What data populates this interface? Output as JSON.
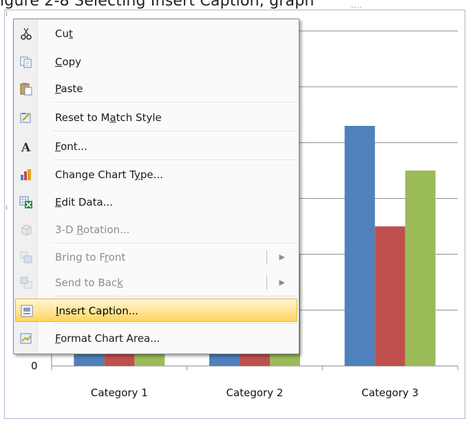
{
  "top_text": "igure 2-8 Selecting Insert Caption, graph",
  "chart_data": {
    "type": "bar",
    "categories": [
      "Category 1",
      "Category 2",
      "Category 3"
    ],
    "series": [
      {
        "values": [
          1.6,
          1.6,
          4.3
        ]
      },
      {
        "values": [
          1.6,
          1.6,
          2.5
        ]
      },
      {
        "values": [
          1.6,
          2.0,
          3.5
        ]
      }
    ],
    "ylim": [
      0,
      6
    ],
    "yticks_visible": [
      "0"
    ],
    "grid": true,
    "colors": [
      "#4f81bd",
      "#c0504d",
      "#9bbb59"
    ]
  },
  "menu": {
    "items": [
      {
        "key": "cut",
        "pre": "Cu",
        "ul": "t",
        "post": "",
        "icon": "scissors-icon",
        "disabled": false,
        "submenu": false,
        "highlight": false
      },
      {
        "key": "copy",
        "pre": "",
        "ul": "C",
        "post": "opy",
        "icon": "copy-icon",
        "disabled": false,
        "submenu": false,
        "highlight": false
      },
      {
        "key": "paste",
        "pre": "",
        "ul": "P",
        "post": "aste",
        "icon": "paste-icon",
        "disabled": false,
        "submenu": false,
        "highlight": false
      },
      {
        "key": "reset",
        "pre": "Reset to M",
        "ul": "a",
        "post": "tch Style",
        "icon": "reset-style-icon",
        "disabled": false,
        "submenu": false,
        "highlight": false
      },
      {
        "key": "font",
        "pre": "",
        "ul": "F",
        "post": "ont...",
        "icon": "font-icon",
        "disabled": false,
        "submenu": false,
        "highlight": false
      },
      {
        "key": "change_type",
        "pre": "Change Chart T",
        "ul": "y",
        "post": "pe...",
        "icon": "chart-type-icon",
        "disabled": false,
        "submenu": false,
        "highlight": false
      },
      {
        "key": "edit_data",
        "pre": "",
        "ul": "E",
        "post": "dit Data...",
        "icon": "edit-data-icon",
        "disabled": false,
        "submenu": false,
        "highlight": false
      },
      {
        "key": "rotation",
        "pre": "3-D ",
        "ul": "R",
        "post": "otation...",
        "icon": "rotation-icon",
        "disabled": true,
        "submenu": false,
        "highlight": false
      },
      {
        "key": "bring_front",
        "pre": "Bring to F",
        "ul": "r",
        "post": "ont",
        "icon": "bring-front-icon",
        "disabled": true,
        "submenu": true,
        "highlight": false
      },
      {
        "key": "send_back",
        "pre": "Send to Bac",
        "ul": "k",
        "post": "",
        "icon": "send-back-icon",
        "disabled": true,
        "submenu": true,
        "highlight": false
      },
      {
        "key": "insert_caption",
        "pre": "",
        "ul": "I",
        "post": "nsert Caption...",
        "icon": "insert-caption-icon",
        "disabled": false,
        "submenu": false,
        "highlight": true
      },
      {
        "key": "format_area",
        "pre": "",
        "ul": "F",
        "post": "ormat Chart Area...",
        "icon": "format-area-icon",
        "disabled": false,
        "submenu": false,
        "highlight": false
      }
    ]
  }
}
